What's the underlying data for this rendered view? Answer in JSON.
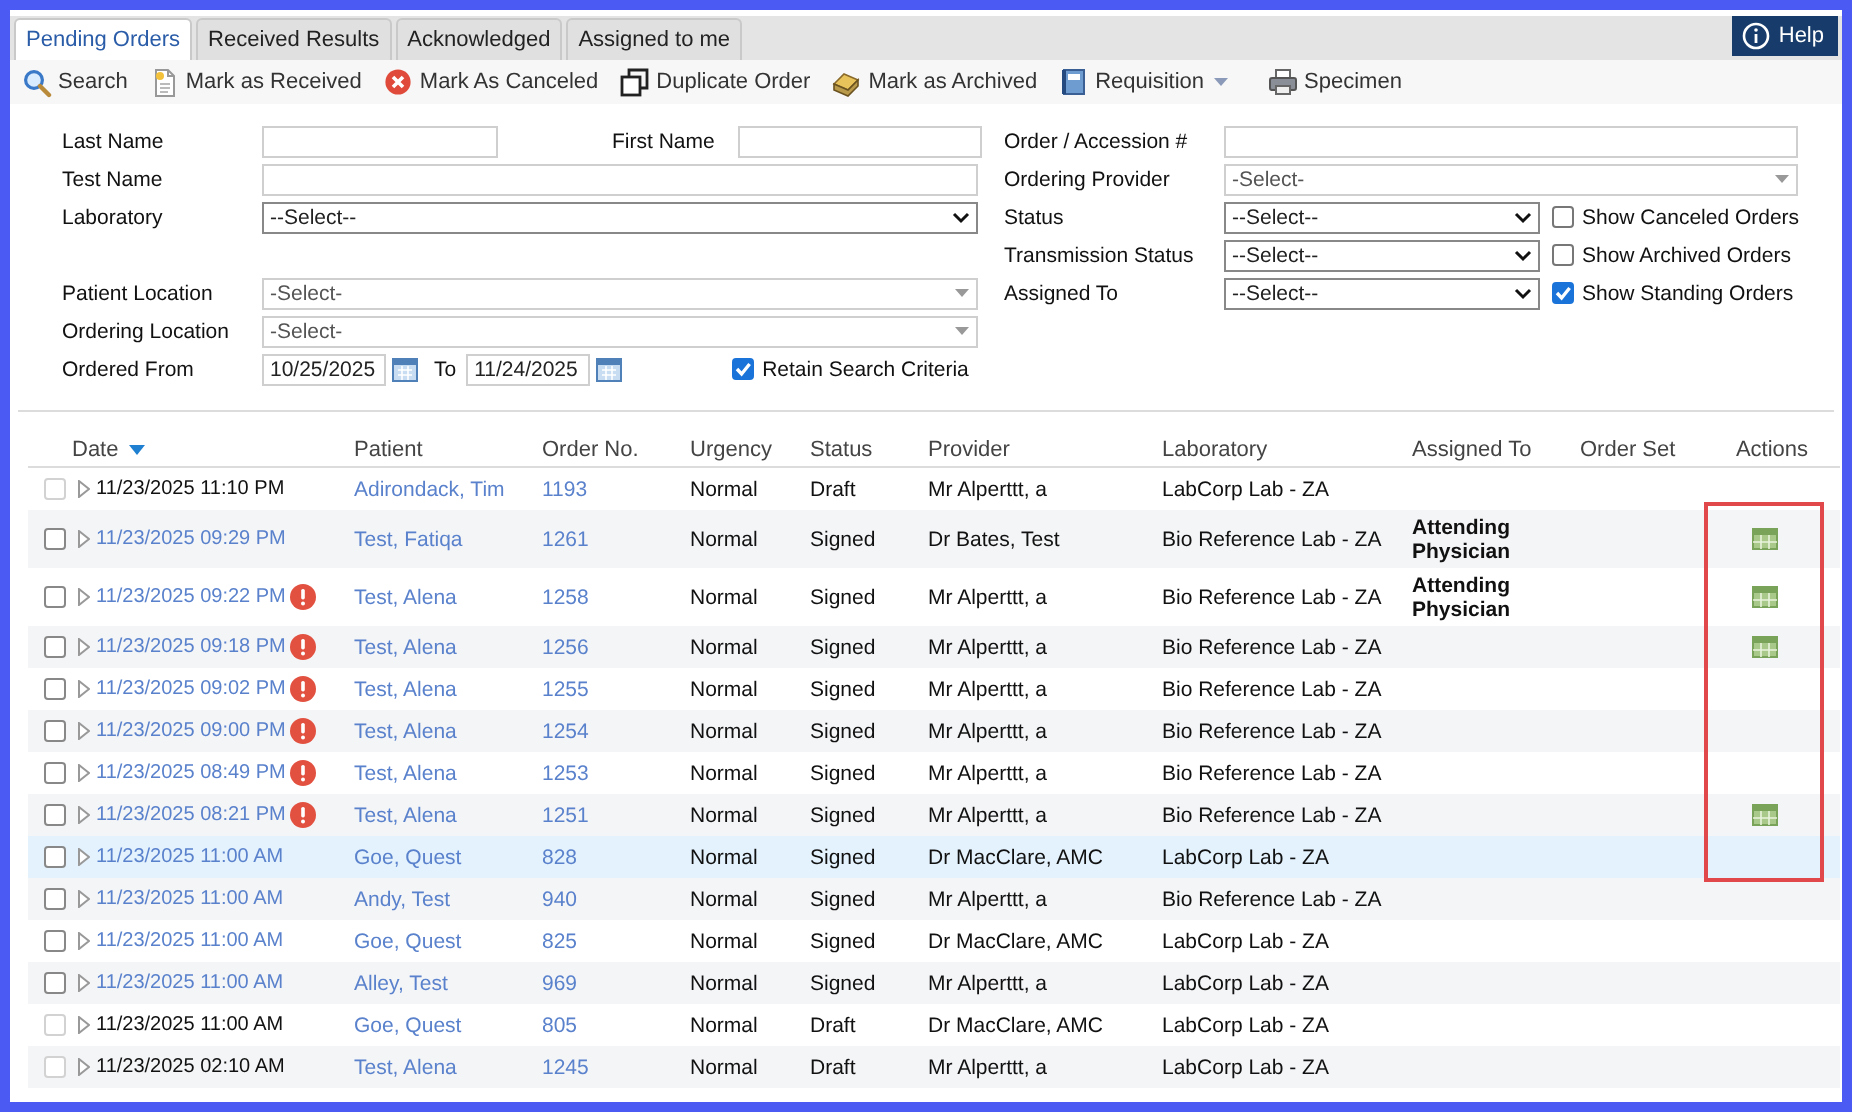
{
  "tabs": [
    {
      "label": "Pending Orders",
      "selected": true
    },
    {
      "label": "Received Results",
      "selected": false
    },
    {
      "label": "Acknowledged",
      "selected": false
    },
    {
      "label": "Assigned to me",
      "selected": false
    }
  ],
  "help_button": "Help",
  "toolbar": [
    {
      "kind": "search",
      "label": "Search"
    },
    {
      "kind": "received",
      "label": "Mark as Received"
    },
    {
      "kind": "cancel",
      "label": "Mark As Canceled"
    },
    {
      "kind": "duplicate",
      "label": "Duplicate Order"
    },
    {
      "kind": "archive",
      "label": "Mark as Archived"
    },
    {
      "kind": "requisition",
      "label": "Requisition",
      "dropdown": true
    },
    {
      "kind": "printer",
      "label": "Specimen"
    }
  ],
  "search_form": [
    {
      "left": [
        {
          "label": "Last Name",
          "kind": "text"
        },
        {
          "label": "First Name",
          "kind": "text"
        }
      ],
      "right": {
        "label": "Order / Accession #",
        "kind": "text"
      }
    },
    {
      "left": [
        {
          "label": "Test Name",
          "kind": "text"
        }
      ],
      "right": {
        "label": "Ordering Provider",
        "kind": "combo",
        "value": "-Select-"
      }
    },
    {
      "left": [
        {
          "label": "Laboratory",
          "kind": "select",
          "value": "--Select--"
        }
      ],
      "right": {
        "label": "Status",
        "kind": "select",
        "value": "--Select--",
        "option": {
          "label": "Show Canceled Orders",
          "checked": false
        }
      }
    },
    {
      "right": {
        "label": "Transmission Status",
        "kind": "select",
        "value": "--Select--",
        "option": {
          "label": "Show Archived Orders",
          "checked": false
        }
      }
    },
    {
      "left": [
        {
          "label": "Patient Location",
          "kind": "combo",
          "value": "-Select-"
        }
      ],
      "right": {
        "label": "Assigned To",
        "kind": "select",
        "value": "--Select--",
        "option": {
          "label": "Show Standing Orders",
          "checked": true
        }
      }
    },
    {
      "left": [
        {
          "label": "Ordering Location",
          "kind": "combo",
          "value": "-Select-"
        }
      ]
    },
    {
      "left": [
        {
          "label": "Ordered From",
          "kind": "date",
          "value": "10/25/2025"
        },
        {
          "label": "To",
          "kind": "date",
          "value": "11/24/2025"
        }
      ],
      "option": {
        "label": "Retain Search Criteria",
        "checked": true
      }
    }
  ],
  "table": {
    "columns": [
      {
        "label": "Date",
        "sorted": true
      },
      {
        "label": "Patient",
        "sorted": false
      },
      {
        "label": "Order No.",
        "sorted": false
      },
      {
        "label": "Urgency",
        "sorted": false
      },
      {
        "label": "Status",
        "sorted": false
      },
      {
        "label": "Provider",
        "sorted": false
      },
      {
        "label": "Laboratory",
        "sorted": false
      },
      {
        "label": "Assigned To",
        "sorted": false
      },
      {
        "label": "Order Set",
        "sorted": false
      },
      {
        "label": "Actions",
        "sorted": false
      }
    ],
    "rows": [
      {
        "date": "11/23/2025 11:10 PM",
        "patient": "Adirondack, Tim",
        "order_no": "1193",
        "urgency": "Normal",
        "status": "Draft",
        "provider": "Mr Alperttt, a",
        "laboratory": "LabCorp Lab - ZA",
        "disabled": true,
        "checked": false,
        "alert": false,
        "has_action": false,
        "selected": false,
        "highlighted": false
      },
      {
        "date": "11/23/2025 09:29 PM",
        "patient": "Test, Fatiqa",
        "order_no": "1261",
        "urgency": "Normal",
        "status": "Signed",
        "provider": "Dr Bates, Test",
        "laboratory": "Bio Reference Lab - ZA",
        "assigned_to": "Attending Physician",
        "disabled": false,
        "checked": false,
        "alert": false,
        "has_action": true,
        "selected": false,
        "highlighted": true
      },
      {
        "date": "11/23/2025 09:22 PM",
        "patient": "Test, Alena",
        "order_no": "1258",
        "urgency": "Normal",
        "status": "Signed",
        "provider": "Mr Alperttt, a",
        "laboratory": "Bio Reference Lab - ZA",
        "assigned_to": "Attending Physician",
        "disabled": false,
        "checked": false,
        "alert": true,
        "has_action": true,
        "selected": false,
        "highlighted": true
      },
      {
        "date": "11/23/2025 09:18 PM",
        "patient": "Test, Alena",
        "order_no": "1256",
        "urgency": "Normal",
        "status": "Signed",
        "provider": "Mr Alperttt, a",
        "laboratory": "Bio Reference Lab - ZA",
        "disabled": false,
        "checked": false,
        "alert": true,
        "has_action": true,
        "selected": false,
        "highlighted": true
      },
      {
        "date": "11/23/2025 09:02 PM",
        "patient": "Test, Alena",
        "order_no": "1255",
        "urgency": "Normal",
        "status": "Signed",
        "provider": "Mr Alperttt, a",
        "laboratory": "Bio Reference Lab - ZA",
        "disabled": false,
        "checked": false,
        "alert": true,
        "has_action": false,
        "selected": false,
        "highlighted": true
      },
      {
        "date": "11/23/2025 09:00 PM",
        "patient": "Test, Alena",
        "order_no": "1254",
        "urgency": "Normal",
        "status": "Signed",
        "provider": "Mr Alperttt, a",
        "laboratory": "Bio Reference Lab - ZA",
        "disabled": false,
        "checked": false,
        "alert": true,
        "has_action": false,
        "selected": false,
        "highlighted": true
      },
      {
        "date": "11/23/2025 08:49 PM",
        "patient": "Test, Alena",
        "order_no": "1253",
        "urgency": "Normal",
        "status": "Signed",
        "provider": "Mr Alperttt, a",
        "laboratory": "Bio Reference Lab - ZA",
        "disabled": false,
        "checked": false,
        "alert": true,
        "has_action": false,
        "selected": false,
        "highlighted": true
      },
      {
        "date": "11/23/2025 08:21 PM",
        "patient": "Test, Alena",
        "order_no": "1251",
        "urgency": "Normal",
        "status": "Signed",
        "provider": "Mr Alperttt, a",
        "laboratory": "Bio Reference Lab - ZA",
        "disabled": false,
        "checked": false,
        "alert": true,
        "has_action": true,
        "selected": false,
        "highlighted": true
      },
      {
        "date": "11/23/2025 11:00 AM",
        "patient": "Goe, Quest",
        "order_no": "828",
        "urgency": "Normal",
        "status": "Signed",
        "provider": "Dr MacClare, AMC",
        "laboratory": "LabCorp Lab - ZA",
        "disabled": false,
        "checked": false,
        "alert": false,
        "has_action": false,
        "selected": true,
        "highlighted": true
      },
      {
        "date": "11/23/2025 11:00 AM",
        "patient": "Andy, Test",
        "order_no": "940",
        "urgency": "Normal",
        "status": "Signed",
        "provider": "Mr Alperttt, a",
        "laboratory": "Bio Reference Lab - ZA",
        "disabled": false,
        "checked": false,
        "alert": false,
        "has_action": false,
        "selected": false,
        "highlighted": false
      },
      {
        "date": "11/23/2025 11:00 AM",
        "patient": "Goe, Quest",
        "order_no": "825",
        "urgency": "Normal",
        "status": "Signed",
        "provider": "Dr MacClare, AMC",
        "laboratory": "LabCorp Lab - ZA",
        "disabled": false,
        "checked": false,
        "alert": false,
        "has_action": false,
        "selected": false,
        "highlighted": false
      },
      {
        "date": "11/23/2025 11:00 AM",
        "patient": "Alley, Test",
        "order_no": "969",
        "urgency": "Normal",
        "status": "Signed",
        "provider": "Mr Alperttt, a",
        "laboratory": "LabCorp Lab - ZA",
        "disabled": false,
        "checked": false,
        "alert": false,
        "has_action": false,
        "selected": false,
        "highlighted": false
      },
      {
        "date": "11/23/2025 11:00 AM",
        "patient": "Goe, Quest",
        "order_no": "805",
        "urgency": "Normal",
        "status": "Draft",
        "provider": "Dr MacClare, AMC",
        "laboratory": "LabCorp Lab - ZA",
        "disabled": true,
        "checked": false,
        "alert": false,
        "has_action": false,
        "selected": false,
        "highlighted": false
      },
      {
        "date": "11/23/2025 02:10 AM",
        "patient": "Test, Alena",
        "order_no": "1245",
        "urgency": "Normal",
        "status": "Draft",
        "provider": "Mr Alperttt, a",
        "laboratory": "LabCorp Lab - ZA",
        "disabled": true,
        "checked": false,
        "alert": false,
        "has_action": false,
        "selected": false,
        "highlighted": false
      }
    ]
  }
}
